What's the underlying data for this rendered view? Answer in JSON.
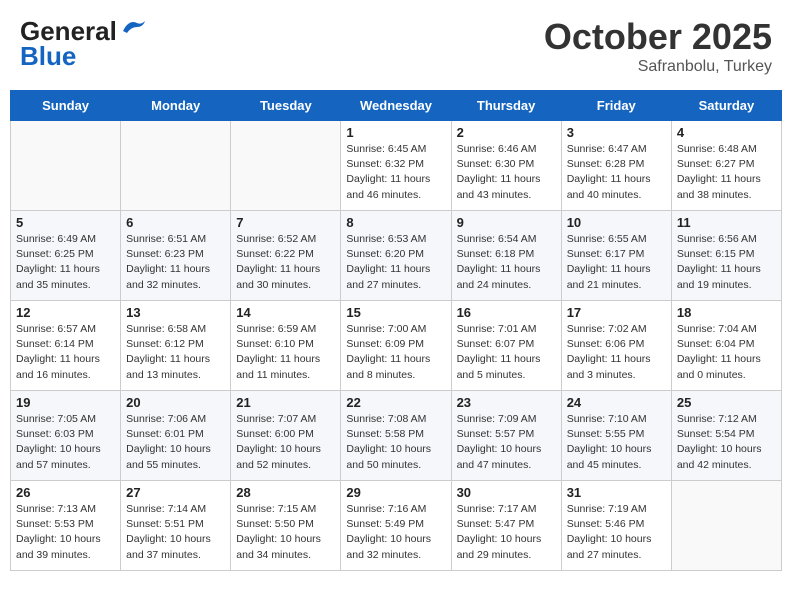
{
  "header": {
    "logo_line1": "General",
    "logo_line2": "Blue",
    "month": "October 2025",
    "location": "Safranbolu, Turkey"
  },
  "days_of_week": [
    "Sunday",
    "Monday",
    "Tuesday",
    "Wednesday",
    "Thursday",
    "Friday",
    "Saturday"
  ],
  "weeks": [
    [
      {
        "day": "",
        "info": ""
      },
      {
        "day": "",
        "info": ""
      },
      {
        "day": "",
        "info": ""
      },
      {
        "day": "1",
        "info": "Sunrise: 6:45 AM\nSunset: 6:32 PM\nDaylight: 11 hours\nand 46 minutes."
      },
      {
        "day": "2",
        "info": "Sunrise: 6:46 AM\nSunset: 6:30 PM\nDaylight: 11 hours\nand 43 minutes."
      },
      {
        "day": "3",
        "info": "Sunrise: 6:47 AM\nSunset: 6:28 PM\nDaylight: 11 hours\nand 40 minutes."
      },
      {
        "day": "4",
        "info": "Sunrise: 6:48 AM\nSunset: 6:27 PM\nDaylight: 11 hours\nand 38 minutes."
      }
    ],
    [
      {
        "day": "5",
        "info": "Sunrise: 6:49 AM\nSunset: 6:25 PM\nDaylight: 11 hours\nand 35 minutes."
      },
      {
        "day": "6",
        "info": "Sunrise: 6:51 AM\nSunset: 6:23 PM\nDaylight: 11 hours\nand 32 minutes."
      },
      {
        "day": "7",
        "info": "Sunrise: 6:52 AM\nSunset: 6:22 PM\nDaylight: 11 hours\nand 30 minutes."
      },
      {
        "day": "8",
        "info": "Sunrise: 6:53 AM\nSunset: 6:20 PM\nDaylight: 11 hours\nand 27 minutes."
      },
      {
        "day": "9",
        "info": "Sunrise: 6:54 AM\nSunset: 6:18 PM\nDaylight: 11 hours\nand 24 minutes."
      },
      {
        "day": "10",
        "info": "Sunrise: 6:55 AM\nSunset: 6:17 PM\nDaylight: 11 hours\nand 21 minutes."
      },
      {
        "day": "11",
        "info": "Sunrise: 6:56 AM\nSunset: 6:15 PM\nDaylight: 11 hours\nand 19 minutes."
      }
    ],
    [
      {
        "day": "12",
        "info": "Sunrise: 6:57 AM\nSunset: 6:14 PM\nDaylight: 11 hours\nand 16 minutes."
      },
      {
        "day": "13",
        "info": "Sunrise: 6:58 AM\nSunset: 6:12 PM\nDaylight: 11 hours\nand 13 minutes."
      },
      {
        "day": "14",
        "info": "Sunrise: 6:59 AM\nSunset: 6:10 PM\nDaylight: 11 hours\nand 11 minutes."
      },
      {
        "day": "15",
        "info": "Sunrise: 7:00 AM\nSunset: 6:09 PM\nDaylight: 11 hours\nand 8 minutes."
      },
      {
        "day": "16",
        "info": "Sunrise: 7:01 AM\nSunset: 6:07 PM\nDaylight: 11 hours\nand 5 minutes."
      },
      {
        "day": "17",
        "info": "Sunrise: 7:02 AM\nSunset: 6:06 PM\nDaylight: 11 hours\nand 3 minutes."
      },
      {
        "day": "18",
        "info": "Sunrise: 7:04 AM\nSunset: 6:04 PM\nDaylight: 11 hours\nand 0 minutes."
      }
    ],
    [
      {
        "day": "19",
        "info": "Sunrise: 7:05 AM\nSunset: 6:03 PM\nDaylight: 10 hours\nand 57 minutes."
      },
      {
        "day": "20",
        "info": "Sunrise: 7:06 AM\nSunset: 6:01 PM\nDaylight: 10 hours\nand 55 minutes."
      },
      {
        "day": "21",
        "info": "Sunrise: 7:07 AM\nSunset: 6:00 PM\nDaylight: 10 hours\nand 52 minutes."
      },
      {
        "day": "22",
        "info": "Sunrise: 7:08 AM\nSunset: 5:58 PM\nDaylight: 10 hours\nand 50 minutes."
      },
      {
        "day": "23",
        "info": "Sunrise: 7:09 AM\nSunset: 5:57 PM\nDaylight: 10 hours\nand 47 minutes."
      },
      {
        "day": "24",
        "info": "Sunrise: 7:10 AM\nSunset: 5:55 PM\nDaylight: 10 hours\nand 45 minutes."
      },
      {
        "day": "25",
        "info": "Sunrise: 7:12 AM\nSunset: 5:54 PM\nDaylight: 10 hours\nand 42 minutes."
      }
    ],
    [
      {
        "day": "26",
        "info": "Sunrise: 7:13 AM\nSunset: 5:53 PM\nDaylight: 10 hours\nand 39 minutes."
      },
      {
        "day": "27",
        "info": "Sunrise: 7:14 AM\nSunset: 5:51 PM\nDaylight: 10 hours\nand 37 minutes."
      },
      {
        "day": "28",
        "info": "Sunrise: 7:15 AM\nSunset: 5:50 PM\nDaylight: 10 hours\nand 34 minutes."
      },
      {
        "day": "29",
        "info": "Sunrise: 7:16 AM\nSunset: 5:49 PM\nDaylight: 10 hours\nand 32 minutes."
      },
      {
        "day": "30",
        "info": "Sunrise: 7:17 AM\nSunset: 5:47 PM\nDaylight: 10 hours\nand 29 minutes."
      },
      {
        "day": "31",
        "info": "Sunrise: 7:19 AM\nSunset: 5:46 PM\nDaylight: 10 hours\nand 27 minutes."
      },
      {
        "day": "",
        "info": ""
      }
    ]
  ]
}
